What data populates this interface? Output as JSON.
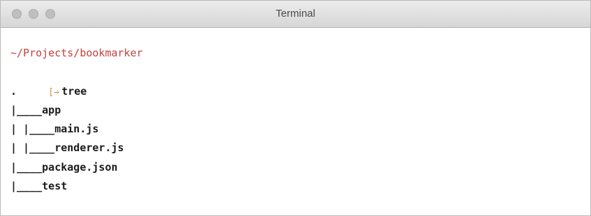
{
  "window": {
    "title": "Terminal"
  },
  "terminal": {
    "cwd": "~/Projects/bookmarker",
    "prompt_symbol": "[→",
    "command": "tree",
    "output": [
      ".",
      "|____app",
      "| |____main.js",
      "| |____renderer.js",
      "|____package.json",
      "|____test"
    ]
  },
  "colors": {
    "cwd": "#c4423f",
    "prompt": "#d88f3f",
    "text": "#1b1b1b",
    "titlebar": "#dcdcdc"
  },
  "icons": {
    "traffic_lights": [
      "close-button",
      "minimize-button",
      "zoom-button"
    ]
  }
}
